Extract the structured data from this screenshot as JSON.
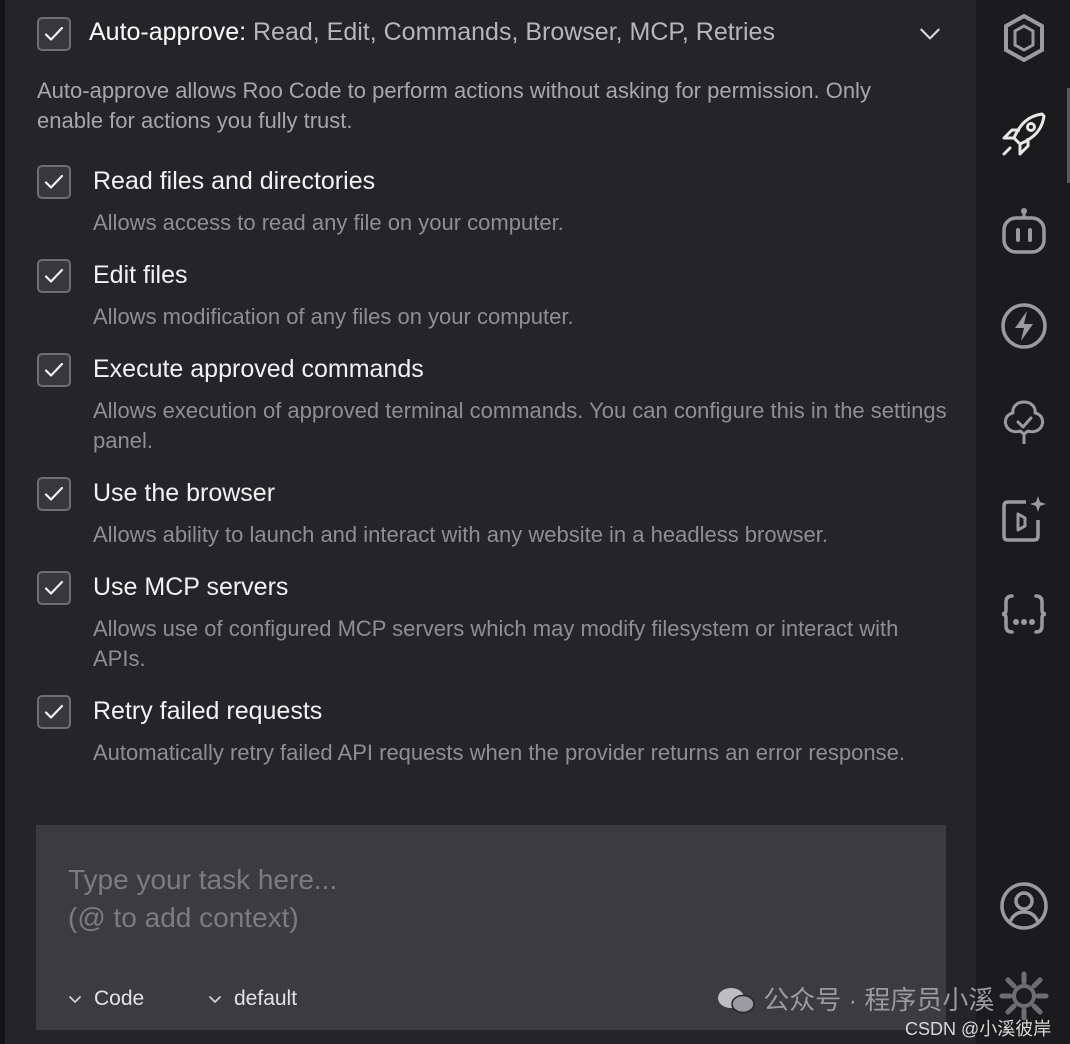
{
  "auto_approve": {
    "label": "Auto-approve:",
    "summary": "Read, Edit, Commands, Browser, MCP, Retries",
    "checked": true,
    "description": "Auto-approve allows Roo Code to perform actions without asking for permission. Only enable for actions you fully trust."
  },
  "options": [
    {
      "title": "Read files and directories",
      "description": "Allows access to read any file on your computer.",
      "checked": true
    },
    {
      "title": "Edit files",
      "description": "Allows modification of any files on your computer.",
      "checked": true
    },
    {
      "title": "Execute approved commands",
      "description": "Allows execution of approved terminal commands. You can configure this in the settings panel.",
      "checked": true
    },
    {
      "title": "Use the browser",
      "description": "Allows ability to launch and interact with any website in a headless browser.",
      "checked": true
    },
    {
      "title": "Use MCP servers",
      "description": "Allows use of configured MCP servers which may modify filesystem or interact with APIs.",
      "checked": true
    },
    {
      "title": "Retry failed requests",
      "description": "Automatically retry failed API requests when the provider returns an error response.",
      "checked": true
    }
  ],
  "task_input": {
    "placeholder": "Type your task here...\n(@ to add context)",
    "mode": "Code",
    "config": "default"
  },
  "activity_bar": [
    {
      "icon": "roo-logo-icon"
    },
    {
      "icon": "rocket-icon"
    },
    {
      "icon": "robot-icon"
    },
    {
      "icon": "lightning-icon"
    },
    {
      "icon": "tree-icon"
    },
    {
      "icon": "notebook-sparkle-icon"
    },
    {
      "icon": "json-braces-icon"
    },
    {
      "icon": "account-icon"
    },
    {
      "icon": "settings-gear-icon"
    }
  ],
  "watermark": "公众号 · 程序员小溪",
  "csdn_credit": "CSDN @小溪彼岸"
}
